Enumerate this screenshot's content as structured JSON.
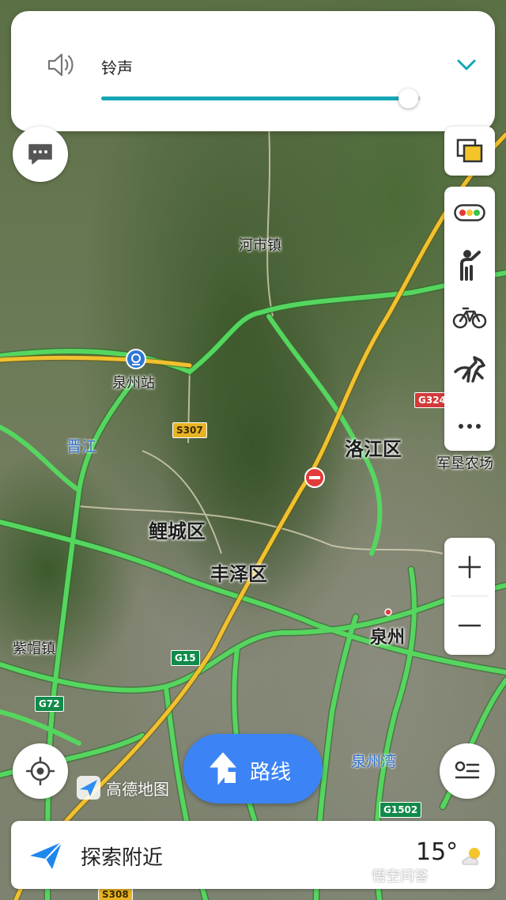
{
  "volume": {
    "label": "铃声",
    "level": 0.96
  },
  "map": {
    "places": {
      "hechang": "河市镇",
      "quanzhou_station": "泉州站",
      "jinjiang": "晋江",
      "licheng": "鲤城区",
      "fengze": "丰泽区",
      "luojiang": "洛江区",
      "junken": "军垦农场",
      "zimao": "紫帽镇",
      "quanzhou": "泉州",
      "quanzhou_bay": "泉州湾"
    },
    "shields": {
      "s307": "S307",
      "g324": "G324",
      "g15": "G15",
      "g72": "G72",
      "g1502": "G1502",
      "s308": "S308"
    },
    "logo": "高德地图"
  },
  "route_button": {
    "label": "路线"
  },
  "bottom_bar": {
    "explore_label": "探索附近",
    "temperature": "15°"
  },
  "watermark": "悟空问答",
  "colors": {
    "accent": "#16a6b6",
    "route_blue": "#3c84f6",
    "road_green": "#4fd05a",
    "road_yellow": "#f2c12e"
  },
  "icons": {
    "volume": "speaker-icon",
    "chevron": "chevron-down-icon",
    "feedback": "message-icon",
    "layers": "layers-icon",
    "traffic": "traffic-light-icon",
    "walk": "guide-person-icon",
    "bike": "bicycle-icon",
    "horse": "horse-icon",
    "more": "more-icon",
    "zoom_in": "plus-icon",
    "zoom_out": "minus-icon",
    "locate": "locate-icon",
    "list": "list-icon",
    "explore": "paper-plane-icon",
    "weather": "partly-cloudy-icon"
  }
}
